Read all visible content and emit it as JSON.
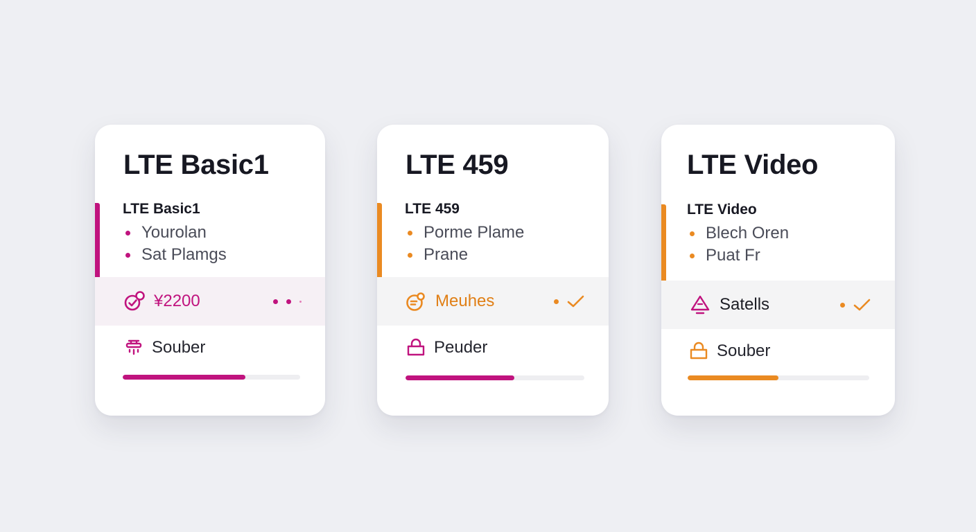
{
  "theme": {
    "magenta": "#c0137e",
    "orange": "#ea8a22"
  },
  "cards": [
    {
      "title": "LTE Basic1",
      "accent": "#c0137e",
      "plan_name": "LTE Basic1",
      "bullets": [
        "Yourolan",
        "Sat Plamgs"
      ],
      "band": {
        "icon": "badge-check-icon",
        "label": "¥2200",
        "label_color": "#c0137e",
        "trail": "dots"
      },
      "feature": {
        "icon": "router-icon",
        "label": "Souber"
      },
      "progress": {
        "value": 0.69,
        "color": "#c0137e"
      }
    },
    {
      "title": "LTE 459",
      "accent": "#ea8a22",
      "plan_name": "LTE 459",
      "bullets": [
        "Porme Plame",
        "Prane"
      ],
      "band": {
        "icon": "chat-bubble-icon",
        "label": "Meuhes",
        "label_color": "#e07f16",
        "trail": "check"
      },
      "feature": {
        "icon": "bag-icon",
        "label": "Peuder"
      },
      "progress": {
        "value": 0.61,
        "color": "#c0137e"
      }
    },
    {
      "title": "LTE Video",
      "accent": "#ea8a22",
      "plan_name": "LTE Video",
      "bullets": [
        "Blech Oren",
        "Puat Fr"
      ],
      "band": {
        "icon": "satellite-triangle-icon",
        "label": "Satells",
        "label_color": "#1c1d24",
        "trail": "check"
      },
      "feature": {
        "icon": "bag-icon",
        "label": "Souber"
      },
      "progress": {
        "value": 0.5,
        "color": "#ea8a22"
      }
    }
  ]
}
